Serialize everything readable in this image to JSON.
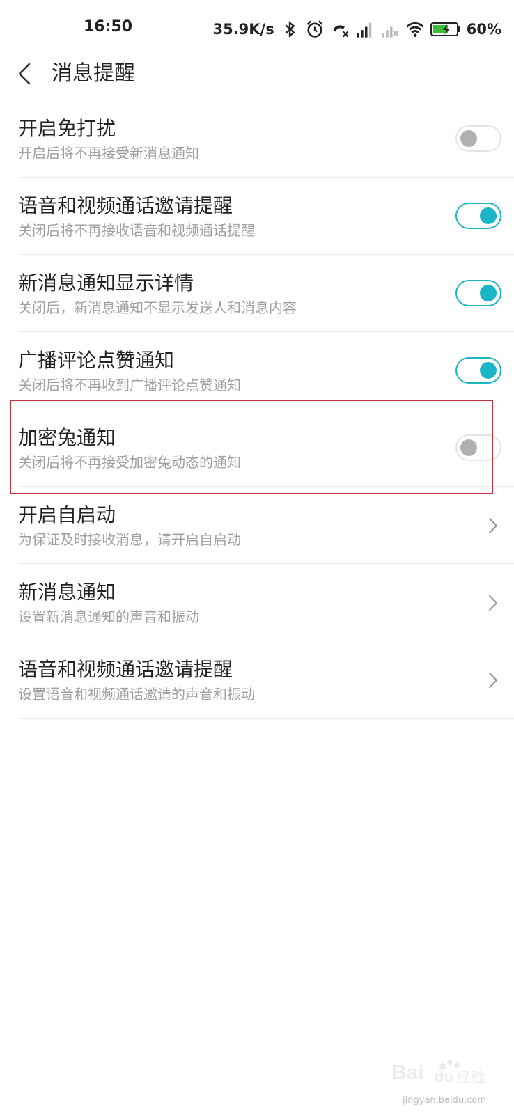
{
  "status_bar": {
    "time": "16:50",
    "net_speed": "35.9K/s",
    "battery_percent": "60%",
    "icons": [
      "bluetooth-icon",
      "alarm-icon",
      "missed-call-icon",
      "signal-icon",
      "signal-no-service-icon",
      "wifi-icon",
      "battery-charging-icon"
    ]
  },
  "header": {
    "title": "消息提醒",
    "back_icon": "chevron-left-icon"
  },
  "settings": [
    {
      "title": "开启免打扰",
      "subtitle": "开启后将不再接受新消息通知",
      "control": "toggle",
      "enabled": false
    },
    {
      "title": "语音和视频通话邀请提醒",
      "subtitle": "关闭后将不再接收语音和视频通话提醒",
      "control": "toggle",
      "enabled": true
    },
    {
      "title": "新消息通知显示详情",
      "subtitle": "关闭后，新消息通知不显示发送人和消息内容",
      "control": "toggle",
      "enabled": true
    },
    {
      "title": "广播评论点赞通知",
      "subtitle": "关闭后将不再收到广播评论点赞通知",
      "control": "toggle",
      "enabled": true
    },
    {
      "title": "加密兔通知",
      "subtitle": "关闭后将不再接受加密兔动态的通知",
      "control": "toggle",
      "enabled": false
    },
    {
      "title": "开启自启动",
      "subtitle": "为保证及时接收消息，请开启自启动",
      "control": "chevron"
    },
    {
      "title": "新消息通知",
      "subtitle": "设置新消息通知的声音和振动",
      "control": "chevron"
    },
    {
      "title": "语音和视频通话邀请提醒",
      "subtitle": "设置语音和视频通话邀请的声音和振动",
      "control": "chevron"
    }
  ],
  "colors": {
    "accent": "#1ab6c7",
    "toggle_off_knob": "#b0b0b0",
    "highlight": "#c8323c",
    "subtitle": "#a0a0a0"
  },
  "watermark": {
    "brand": "Baidu经验",
    "url": "jingyan.baidu.com"
  }
}
